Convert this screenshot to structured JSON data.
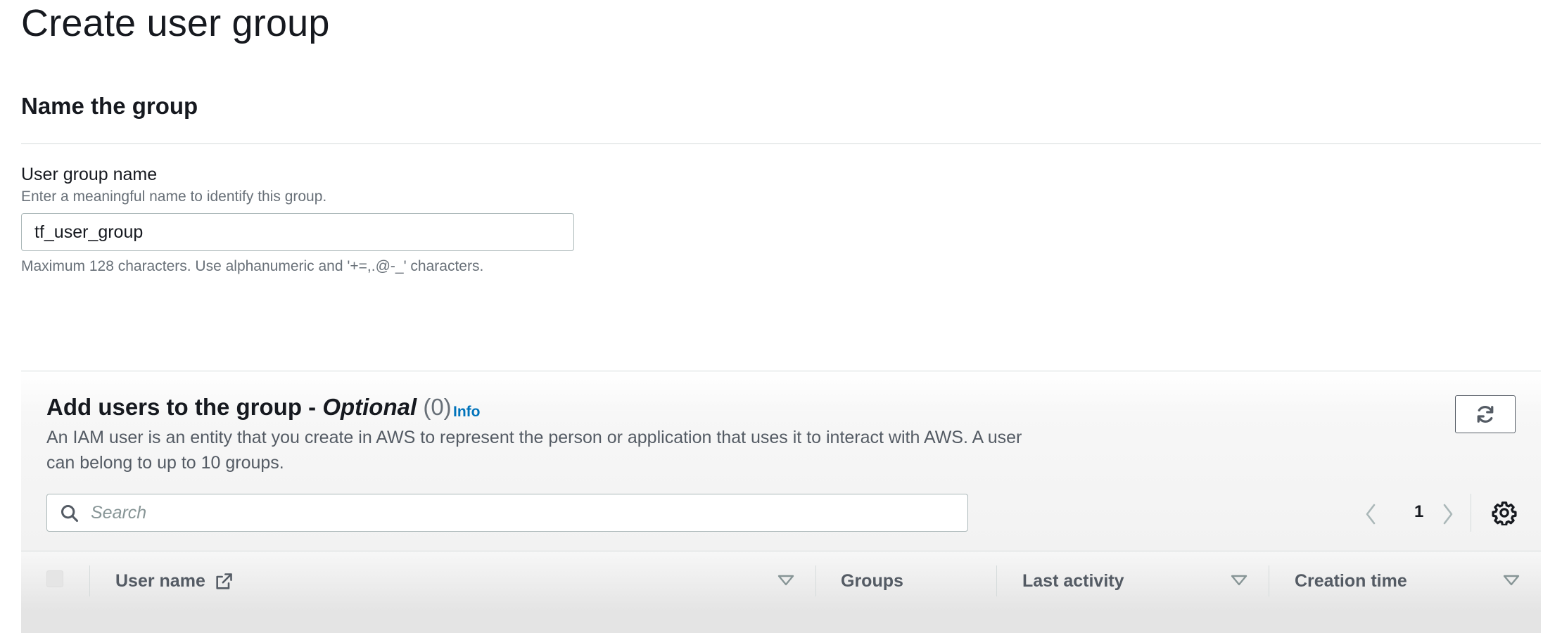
{
  "page": {
    "title": "Create user group"
  },
  "name_section": {
    "title": "Name the group",
    "field_label": "User group name",
    "field_description": "Enter a meaningful name to identify this group.",
    "field_value": "tf_user_group",
    "constraint": "Maximum 128 characters. Use alphanumeric and '+=,.@-_' characters."
  },
  "users_section": {
    "title": "Add users to the group - ",
    "title_optional": "Optional",
    "count": "(0)",
    "info_link": "Info",
    "description": "An IAM user is an entity that you create in AWS to represent the person or application that uses it to interact with AWS. A user can belong to up to 10 groups.",
    "search_placeholder": "Search",
    "pagination": {
      "current_page": "1"
    },
    "columns": [
      {
        "label": "User name",
        "sortable": true,
        "external_link_icon": "external-link-icon"
      },
      {
        "label": "Groups",
        "sortable": false
      },
      {
        "label": "Last activity",
        "sortable": true
      },
      {
        "label": "Creation time",
        "sortable": true
      }
    ],
    "icons": {
      "refresh": "refresh-icon",
      "search": "search-icon",
      "previous": "chevron-left-icon",
      "next": "chevron-right-icon",
      "settings": "gear-icon",
      "sort": "caret-down-icon"
    }
  },
  "colors": {
    "link": "#0073bb",
    "text_primary": "#16191f",
    "text_secondary": "#687078",
    "border": "#aab7b8"
  }
}
